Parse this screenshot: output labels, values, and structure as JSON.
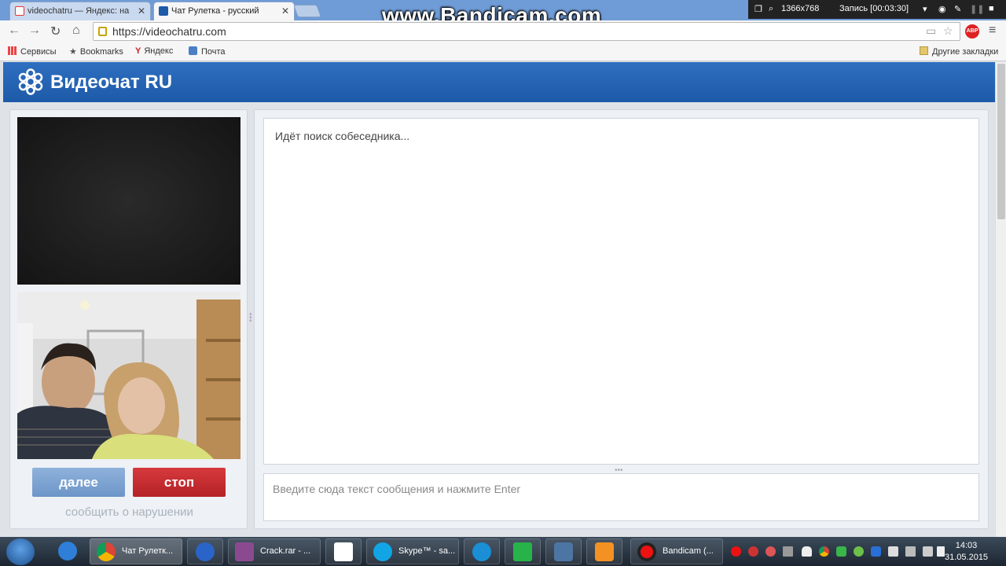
{
  "browser": {
    "tabs": [
      {
        "title": "videochatru — Яндекс: на",
        "active": false
      },
      {
        "title": "Чат Рулетка - русский",
        "active": true
      }
    ],
    "url": "https://videochatru.com",
    "bookmarks": [
      {
        "label": "Сервисы",
        "icon": "apps-grid-icon"
      },
      {
        "label": "Bookmarks",
        "icon": "star-icon"
      },
      {
        "label": "Яндекс",
        "icon": "yandex-icon"
      },
      {
        "label": "Почта",
        "icon": "mail-icon"
      }
    ],
    "other_bookmarks": "Другие закладки",
    "adblock_badge": "ABP"
  },
  "overlay": {
    "watermark": "www.Bandicam.com",
    "resolution": "1366x768",
    "recording": "Запись [00:03:30]"
  },
  "site": {
    "logo_text": "Видеочат RU",
    "next_button": "далее",
    "stop_button": "стоп",
    "report_link": "сообщить о нарушении",
    "chat_status": "Идёт поиск собеседника...",
    "chat_placeholder": "Введите сюда текст сообщения и нажмите Enter"
  },
  "taskbar": {
    "items": [
      {
        "label": "Чат Рулетк...",
        "icon": "chrome-icon"
      },
      {
        "label": "",
        "icon": "help-icon"
      },
      {
        "label": "Crack.rar - ...",
        "icon": "winrar-icon"
      },
      {
        "label": "",
        "icon": "apps-icon"
      },
      {
        "label": "Skype™ - sa...",
        "icon": "skype-icon"
      },
      {
        "label": "",
        "icon": "mail-agent-icon"
      },
      {
        "label": "",
        "icon": "a-icon"
      },
      {
        "label": "",
        "icon": "vk-icon"
      },
      {
        "label": "",
        "icon": "odnoklassniki-icon"
      },
      {
        "label": "Bandicam (...",
        "icon": "bandicam-icon"
      }
    ],
    "time": "14:03",
    "date": "31.05.2015"
  },
  "colors": {
    "header_blue": "#1d5aa8",
    "next_button": "#7aa0cf",
    "stop_button": "#c42b2f"
  }
}
